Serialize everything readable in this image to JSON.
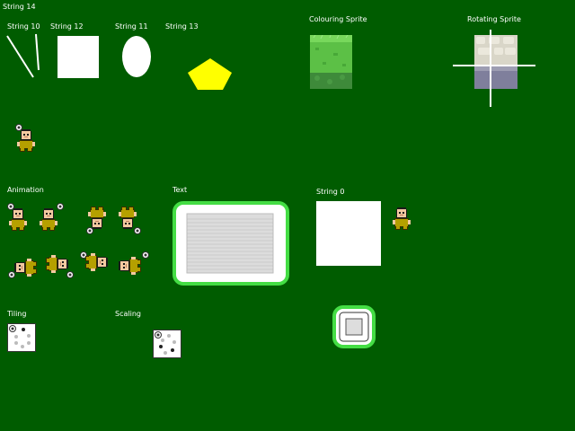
{
  "labels": {
    "string14": "String 14",
    "string10": "String 10",
    "string12": "String 12",
    "string11": "String 11",
    "string13": "String 13",
    "colouring": "Colouring Sprite",
    "rotating": "Rotating Sprite",
    "animation": "Animation",
    "text": "Text",
    "string0": "String 0",
    "tiling": "Tiling",
    "scaling": "Scaling"
  },
  "colors": {
    "background": "#005c00",
    "white": "#ffffff",
    "pentagon": "#ffff00",
    "char_body": "#b5a000",
    "char_skin": "#f4c9a0",
    "frame_green": "#44dd44"
  },
  "sprites": {
    "character": "bald-man-character-sprite",
    "colouring": "grass-block-sprite",
    "rotating": "stone-block-sprite",
    "frame": "rounded-panel-frame"
  }
}
